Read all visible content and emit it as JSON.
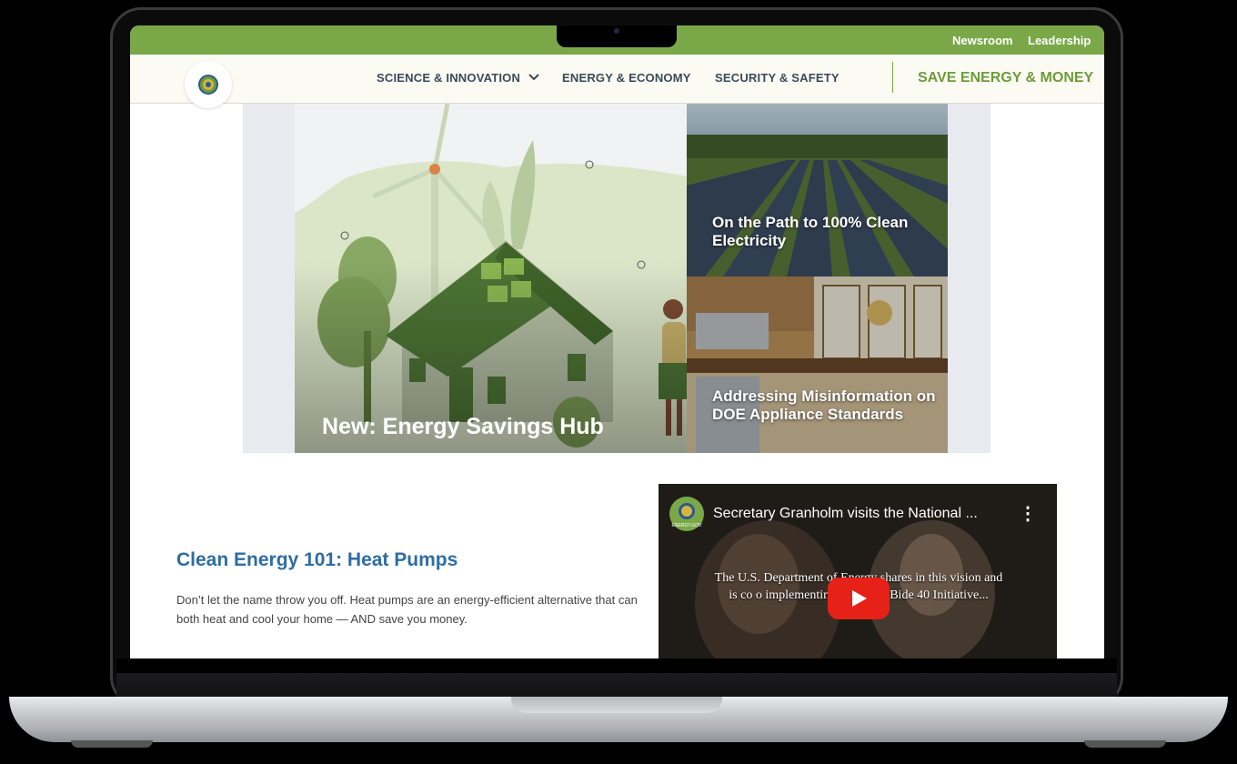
{
  "utility": {
    "newsroom": "Newsroom",
    "leadership": "Leadership"
  },
  "nav": {
    "science": "SCIENCE & INNOVATION",
    "economy": "ENERGY & ECONOMY",
    "security": "SECURITY & SAFETY",
    "save": "SAVE ENERGY & MONEY"
  },
  "hero": {
    "main_title": "New: Energy Savings Hub",
    "tiles": [
      {
        "title": "On the Path to 100% Clean Electricity"
      },
      {
        "title": "Addressing Misinformation on DOE Appliance Standards"
      }
    ]
  },
  "feature": {
    "heading": "Clean Energy 101: Heat Pumps",
    "text": "Don’t let the name throw you off. Heat pumps are an energy-efficient alternative that can both heat and cool your home — AND save you money."
  },
  "video": {
    "title": "Secretary Granholm visits the National ...",
    "channel_label": "ENERGY.GOV",
    "caption": "The U.S. Department of Energy shares in this vision and is co        o implementing President Bide        40 Initiative..."
  },
  "colors": {
    "brand_green": "#7aa848",
    "link_blue": "#2e6da4",
    "nav_text": "#3a4a5a"
  },
  "icons": [
    "doe-seal-icon",
    "chevron-down-icon",
    "play-icon",
    "more-vert-icon"
  ]
}
